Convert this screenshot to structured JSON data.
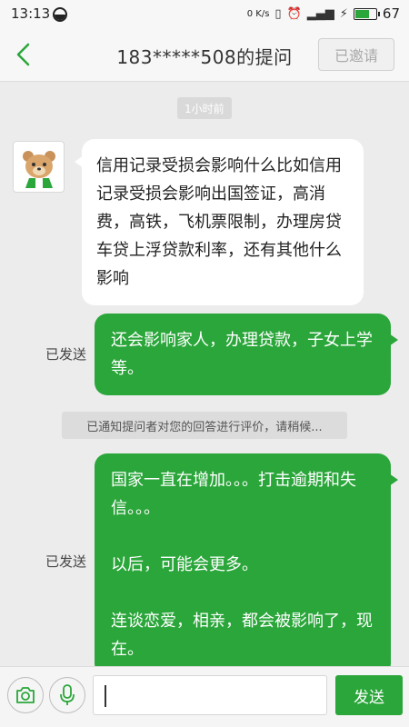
{
  "status_bar": {
    "time": "13:13",
    "net_speed": "0 K/s",
    "battery": "67",
    "battery_fraction": 0.67
  },
  "header": {
    "title": "183*****508的提问",
    "invited_label": "已邀请"
  },
  "chat": {
    "timestamp": "1小时前",
    "question": "信用记录受损会影响什么比如信用记录受损会影响出国签证，高消费，高铁，飞机票限制，办理房贷车贷上浮贷款利率，还有其他什么影响",
    "answer1": "还会影响家人，办理贷款，子女上学等。",
    "answer1_status": "已发送",
    "notice": "已通知提问者对您的回答进行评价，请稍候...",
    "answer2_lines": [
      "国家一直在增加。。。打击逾期和失信。。。",
      "",
      "以后，可能会更多。",
      "",
      "连谈恋爱，相亲，都会被影响了，现在。"
    ],
    "answer2_status": "已发送"
  },
  "input_bar": {
    "send_label": "发送"
  },
  "colors": {
    "accent": "#2aa63a",
    "background": "#ececec"
  },
  "icons": [
    "back-arrow-icon",
    "camera-icon",
    "microphone-icon",
    "bear-avatar"
  ]
}
